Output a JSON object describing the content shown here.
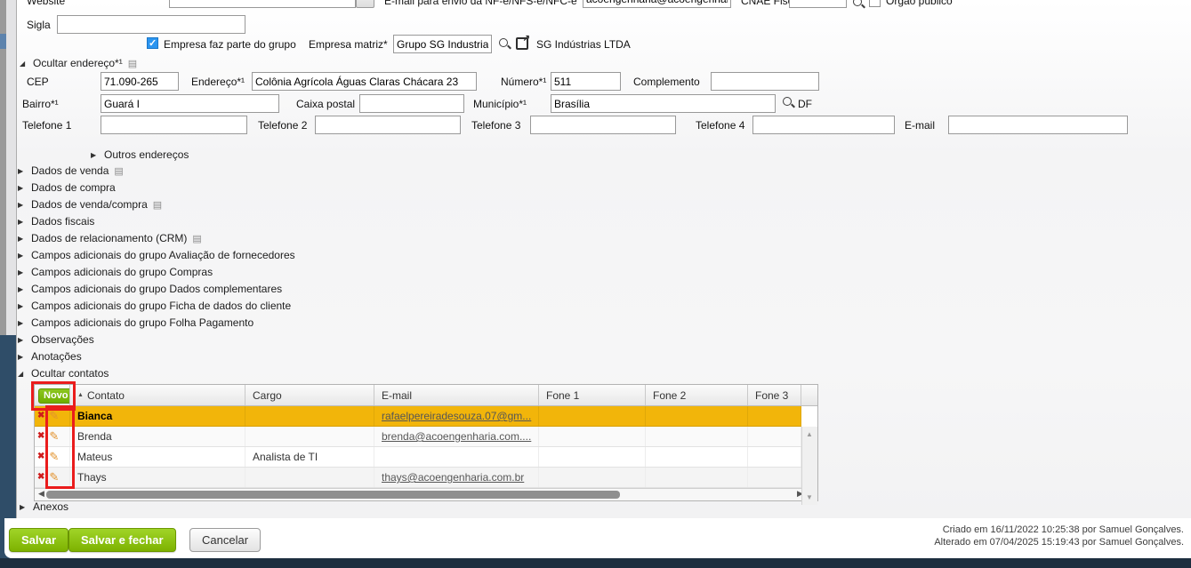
{
  "icons": {
    "collapsed": "▶",
    "expanded": "◢",
    "doc": "▤",
    "sort_asc": "▲",
    "up": "▲",
    "down": "▼",
    "left": "◀",
    "right": "▶",
    "external": "↗",
    "check": "✓",
    "delete": "✖",
    "edit": "✎",
    "envelope": "✉"
  },
  "topbar": {
    "website_label": "Website",
    "website_value": "",
    "email_nf_label": "E-mail para envio da NF-e/NFS-e/NFC-e",
    "email_nf_value": "acoengenharia@acoengenharia.com.br",
    "cnae_label": "CNAE Fiscal",
    "cnae_value": "",
    "orgao_publico_label": "Órgão público"
  },
  "identification": {
    "sigla_label": "Sigla",
    "sigla_value": "",
    "grupo_checkbox_label": "Empresa faz parte do grupo",
    "empresa_matriz_label": "Empresa matriz*",
    "empresa_matriz_value": "Grupo SG Industria",
    "empresa_matriz_link": "SG Indústrias LTDA"
  },
  "address": {
    "section_title": "Ocultar endereço*¹",
    "cep_label": "CEP",
    "cep_value": "71.090-265",
    "endereco_label": "Endereço*¹",
    "endereco_value": "Colônia Agrícola Águas Claras Chácara 23",
    "numero_label": "Número*¹",
    "numero_value": "511",
    "complemento_label": "Complemento",
    "complemento_value": "",
    "bairro_label": "Bairro*¹",
    "bairro_value": "Guará I",
    "caixa_postal_label": "Caixa postal",
    "caixa_postal_value": "",
    "municipio_label": "Município*¹",
    "municipio_value": "Brasília",
    "uf_value": "DF",
    "telefone1_label": "Telefone 1",
    "telefone2_label": "Telefone 2",
    "telefone3_label": "Telefone 3",
    "telefone4_label": "Telefone 4",
    "email_label": "E-mail",
    "outros_enderecos_label": "Outros endereços"
  },
  "sections": [
    {
      "label": "Dados de venda",
      "doc_icon": true
    },
    {
      "label": "Dados de compra",
      "doc_icon": false
    },
    {
      "label": "Dados de venda/compra",
      "doc_icon": true
    },
    {
      "label": "Dados fiscais",
      "doc_icon": false
    },
    {
      "label": "Dados de relacionamento (CRM)",
      "doc_icon": true
    },
    {
      "label": "Campos adicionais do grupo Avaliação de fornecedores",
      "doc_icon": false
    },
    {
      "label": "Campos adicionais do grupo Compras",
      "doc_icon": false
    },
    {
      "label": "Campos adicionais do grupo Dados complementares",
      "doc_icon": false
    },
    {
      "label": "Campos adicionais do grupo Ficha de dados do cliente",
      "doc_icon": false
    },
    {
      "label": "Campos adicionais do grupo Folha Pagamento",
      "doc_icon": false
    },
    {
      "label": "Observações",
      "doc_icon": false
    },
    {
      "label": "Anotações",
      "doc_icon": false
    }
  ],
  "contacts": {
    "section_title": "Ocultar contatos",
    "new_button_label": "Novo",
    "columns": {
      "contato": "Contato",
      "cargo": "Cargo",
      "email": "E-mail",
      "fone1": "Fone 1",
      "fone2": "Fone 2",
      "fone3": "Fone 3"
    },
    "rows": [
      {
        "contato": "Bianca",
        "cargo": "",
        "email": "rafaelpereiradesouza.07@gm...",
        "fone1": "",
        "fone2": "",
        "fone3": "",
        "selected": true
      },
      {
        "contato": "Brenda",
        "cargo": "",
        "email": "brenda@acoengenharia.com....",
        "fone1": "",
        "fone2": "",
        "fone3": "",
        "selected": false
      },
      {
        "contato": "Mateus",
        "cargo": "Analista de TI",
        "email": "",
        "fone1": "",
        "fone2": "",
        "fone3": "",
        "selected": false
      },
      {
        "contato": "Thays",
        "cargo": "",
        "email": "thays@acoengenharia.com.br",
        "fone1": "",
        "fone2": "",
        "fone3": "",
        "selected": false
      }
    ]
  },
  "anexos_label": "Anexos",
  "footer": {
    "save_label": "Salvar",
    "save_close_label": "Salvar e fechar",
    "cancel_label": "Cancelar",
    "created_text": "Criado em 16/11/2022 10:25:38 por Samuel Gonçalves.",
    "updated_text": "Alterado em 07/04/2025 15:19:43 por Samuel Gonçalves."
  },
  "colors": {
    "accent_green": "#7db200",
    "selected_row_orange": "#f2b50a",
    "annotation_red": "#ea1c1c",
    "checkbox_blue": "#2b95f0",
    "bottom_bar_navy": "#1d2e3f",
    "side_panel_navy": "#2f4d68"
  }
}
